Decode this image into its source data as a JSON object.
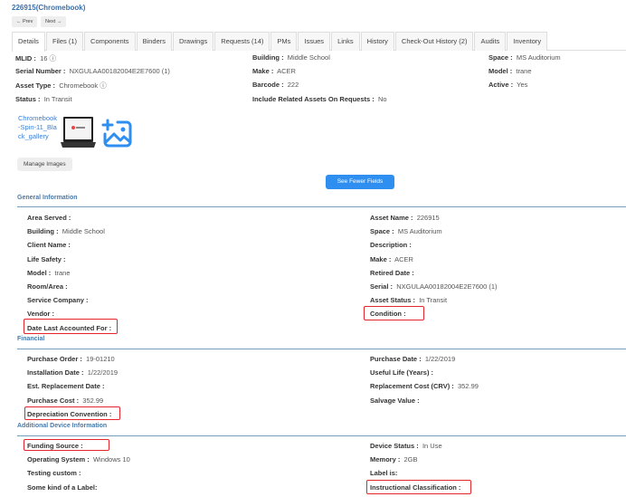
{
  "title": "226915(Chromebook)",
  "nav": {
    "prev": "← Prev",
    "next": "Next →"
  },
  "tabs": [
    "Details",
    "Files (1)",
    "Components",
    "Binders",
    "Drawings",
    "Requests (14)",
    "PMs",
    "Issues",
    "Links",
    "History",
    "Check-Out History (2)",
    "Audits",
    "Inventory"
  ],
  "summary": {
    "mlid": {
      "label": "MLID :",
      "value": "16 ⓘ"
    },
    "serial": {
      "label": "Serial Number :",
      "value": "NXGULAA00182004E2E7600 (1)"
    },
    "asset_type": {
      "label": "Asset Type :",
      "value": "Chromebook ⓘ"
    },
    "status": {
      "label": "Status :",
      "value": "In Transit"
    },
    "building": {
      "label": "Building :",
      "value": "Middle School"
    },
    "make": {
      "label": "Make :",
      "value": "ACER"
    },
    "barcode": {
      "label": "Barcode :",
      "value": "222"
    },
    "related": {
      "label": "Include Related Assets On Requests :",
      "value": "No"
    },
    "space": {
      "label": "Space :",
      "value": "MS Auditorium"
    },
    "model": {
      "label": "Model :",
      "value": "trane"
    },
    "active": {
      "label": "Active :",
      "value": "Yes"
    }
  },
  "images": {
    "alt": "Chromebook-Spin-11_Black_gallery",
    "manage": "Manage Images"
  },
  "see_fewer": "See Fewer Fields",
  "sections": {
    "general": {
      "title": "General Information",
      "left": [
        [
          "Area Served :",
          ""
        ],
        [
          "Building :",
          "Middle School"
        ],
        [
          "Client Name :",
          ""
        ],
        [
          "Life Safety :",
          ""
        ],
        [
          "Model :",
          "trane"
        ],
        [
          "Room/Area :",
          ""
        ],
        [
          "Service Company :",
          ""
        ],
        [
          "Vendor :",
          ""
        ],
        [
          "Date Last Accounted For :",
          ""
        ]
      ],
      "right": [
        [
          "Asset Name :",
          "226915"
        ],
        [
          "Space :",
          "MS Auditorium"
        ],
        [
          "Description :",
          ""
        ],
        [
          "Make :",
          "ACER"
        ],
        [
          "Retired Date :",
          ""
        ],
        [
          "Serial :",
          "NXGULAA00182004E2E7600 (1)"
        ],
        [
          "Asset Status :",
          "In Transit"
        ],
        [
          "Condition :",
          ""
        ]
      ]
    },
    "financial": {
      "title": "Financial",
      "left": [
        [
          "Purchase Order :",
          "19-01210"
        ],
        [
          "Installation Date :",
          "1/22/2019"
        ],
        [
          "Est. Replacement Date :",
          ""
        ],
        [
          "Purchase Cost :",
          "352.99"
        ],
        [
          "Depreciation Convention :",
          ""
        ]
      ],
      "right": [
        [
          "Purchase Date :",
          "1/22/2019"
        ],
        [
          "Useful Life (Years) :",
          ""
        ],
        [
          "Replacement Cost (CRV) :",
          "352.99"
        ],
        [
          "Salvage Value :",
          ""
        ]
      ]
    },
    "device": {
      "title": "Additional Device Information",
      "left": [
        [
          "Funding Source :",
          ""
        ],
        [
          "Operating System :",
          "Windows 10"
        ],
        [
          "Testing custom :",
          ""
        ],
        [
          "Some kind of a Label:",
          ""
        ]
      ],
      "right": [
        [
          "Device Status :",
          "In Use"
        ],
        [
          "Memory :",
          "2GB"
        ],
        [
          "Label is:",
          ""
        ],
        [
          "Instructional Classification :",
          ""
        ]
      ]
    }
  },
  "colors": {
    "accent": "#2f8ff0",
    "highlight": "#e5252a",
    "link": "#3b6fa8"
  }
}
